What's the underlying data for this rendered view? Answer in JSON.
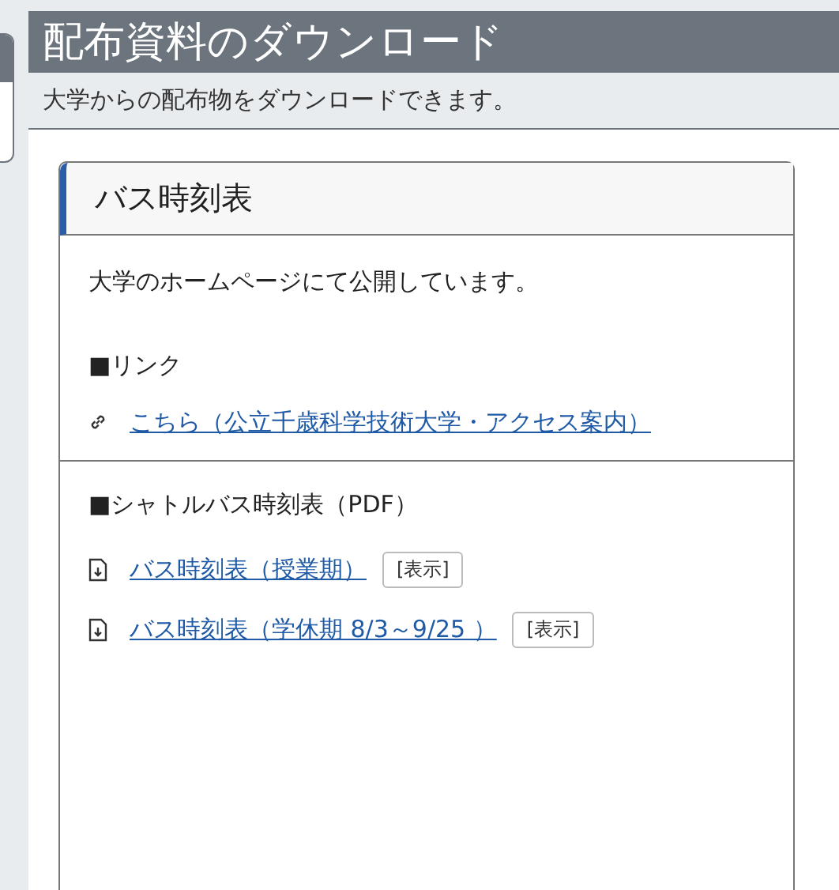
{
  "page": {
    "title": "配布資料のダウンロード",
    "subtitle": "大学からの配布物をダウンロードできます。"
  },
  "card": {
    "title": "バス時刻表",
    "sections": [
      {
        "intro": "大学のホームページにて公開しています。",
        "heading": "■リンク",
        "items": [
          {
            "kind": "link",
            "label": "こちら（公立千歳科学技術大学・アクセス案内）"
          }
        ]
      },
      {
        "heading": "■シャトルバス時刻表（PDF）",
        "items": [
          {
            "kind": "file",
            "label": "バス時刻表（授業期）",
            "button": "[表示]"
          },
          {
            "kind": "file",
            "label": "バス時刻表（学休期 8/3～9/25 ）",
            "button": "[表示]"
          }
        ]
      }
    ]
  }
}
